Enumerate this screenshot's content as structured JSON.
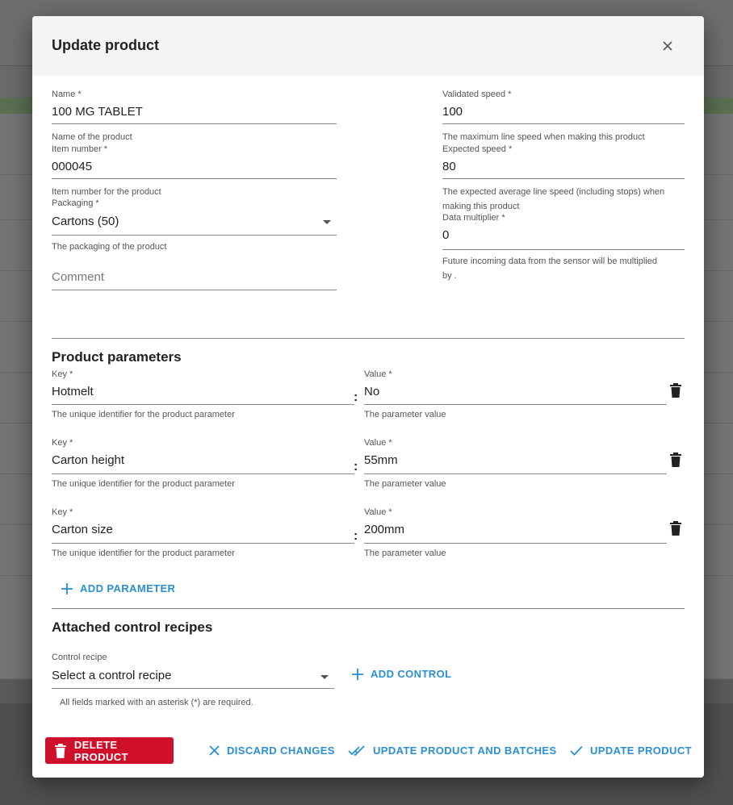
{
  "dialog": {
    "title": "Update product"
  },
  "form": {
    "name": {
      "label": "Name *",
      "value": "100 MG TABLET",
      "hint": "Name of the product"
    },
    "item_number": {
      "label": "Item number *",
      "value": "000045",
      "hint": "Item number for the product"
    },
    "packaging": {
      "label": "Packaging *",
      "value": "Cartons (50)",
      "hint": "The packaging of the product"
    },
    "comment": {
      "placeholder": "Comment"
    },
    "validated_speed": {
      "label": "Validated speed *",
      "value": "100",
      "hint": "The maximum line speed when making this product"
    },
    "expected_speed": {
      "label": "Expected speed *",
      "value": "80",
      "hint_line1": "The expected average line speed (including stops) when",
      "hint_line2": "making this product"
    },
    "data_multiplier": {
      "label": "Data multiplier *",
      "value": "0",
      "hint_line1": "Future incoming data from the sensor will be multiplied",
      "hint_line2": "by ."
    }
  },
  "parameters": {
    "title": "Product parameters",
    "key_label": "Key *",
    "value_label": "Value *",
    "key_hint": "The unique identifier for the product parameter",
    "value_hint": "The parameter value",
    "separator": ":",
    "rows": [
      {
        "key": "Hotmelt",
        "value": "No"
      },
      {
        "key": "Carton height",
        "value": "55mm"
      },
      {
        "key": "Carton size",
        "value": "200mm"
      }
    ],
    "add_label": "ADD PARAMETER"
  },
  "controls": {
    "title": "Attached control recipes",
    "label": "Control recipe",
    "value": "Select a control recipe",
    "add_label": "ADD CONTROL",
    "required_note": "All fields marked with an asterisk (*) are required."
  },
  "actions": {
    "delete": "DELETE PRODUCT",
    "discard": "DISCARD CHANGES",
    "update_batches": "UPDATE PRODUCT AND BATCHES",
    "update": "UPDATE PRODUCT"
  },
  "colors": {
    "accent": "#2a8fd1",
    "danger": "#d0102a"
  }
}
